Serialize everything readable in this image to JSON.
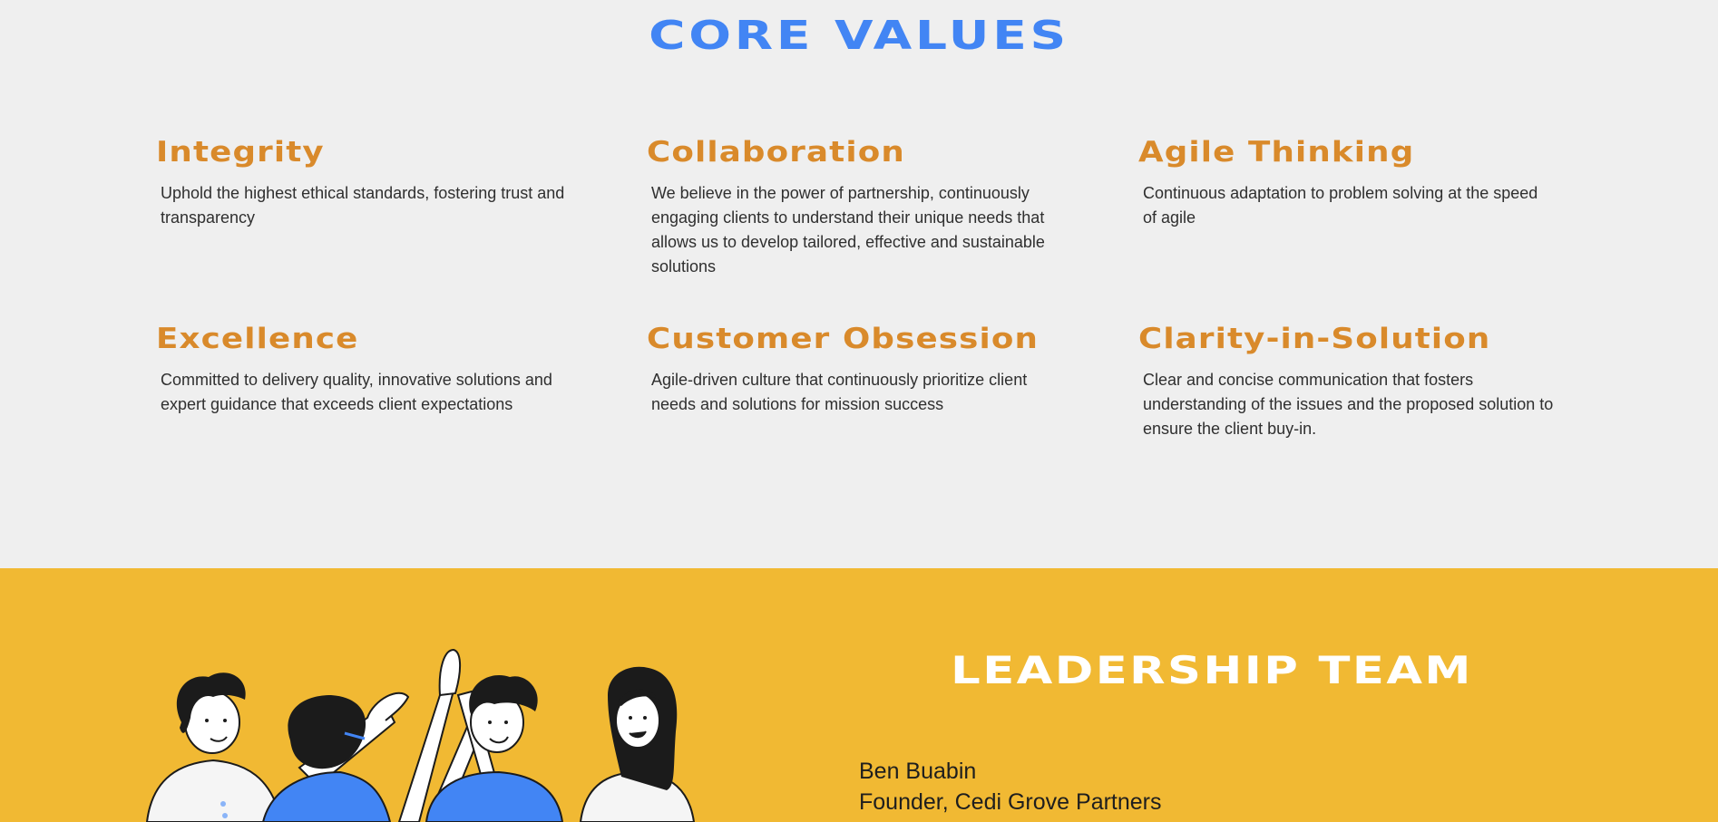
{
  "core_values": {
    "title": "CORE VALUES",
    "items": [
      {
        "title": "Integrity",
        "desc": "Uphold the highest ethical standards, fostering trust and transparency"
      },
      {
        "title": "Collaboration",
        "desc": "We believe in the power of partnership, continuously engaging clients to understand their unique needs that allows us to develop tailored, effective and sustainable solutions"
      },
      {
        "title": "Agile Thinking",
        "desc": "Continuous adaptation to problem solving at the speed of agile"
      },
      {
        "title": "Excellence",
        "desc": "Committed to delivery quality, innovative solutions and expert guidance that exceeds client expectations"
      },
      {
        "title": "Customer Obsession",
        "desc": "Agile-driven culture that continuously prioritize client needs and solutions for mission success"
      },
      {
        "title": "Clarity-in-Solution",
        "desc": "Clear and concise communication that fosters understanding of the issues and the proposed solution to ensure the client buy-in."
      }
    ]
  },
  "leadership": {
    "title": "LEADERSHIP TEAM",
    "leader_name": "Ben Buabin",
    "leader_role": "Founder, Cedi Grove Partners"
  },
  "colors": {
    "title_blue": "#4285f4",
    "value_orange": "#d98a2b",
    "section_yellow": "#f1b933",
    "page_bg": "#efefef"
  }
}
